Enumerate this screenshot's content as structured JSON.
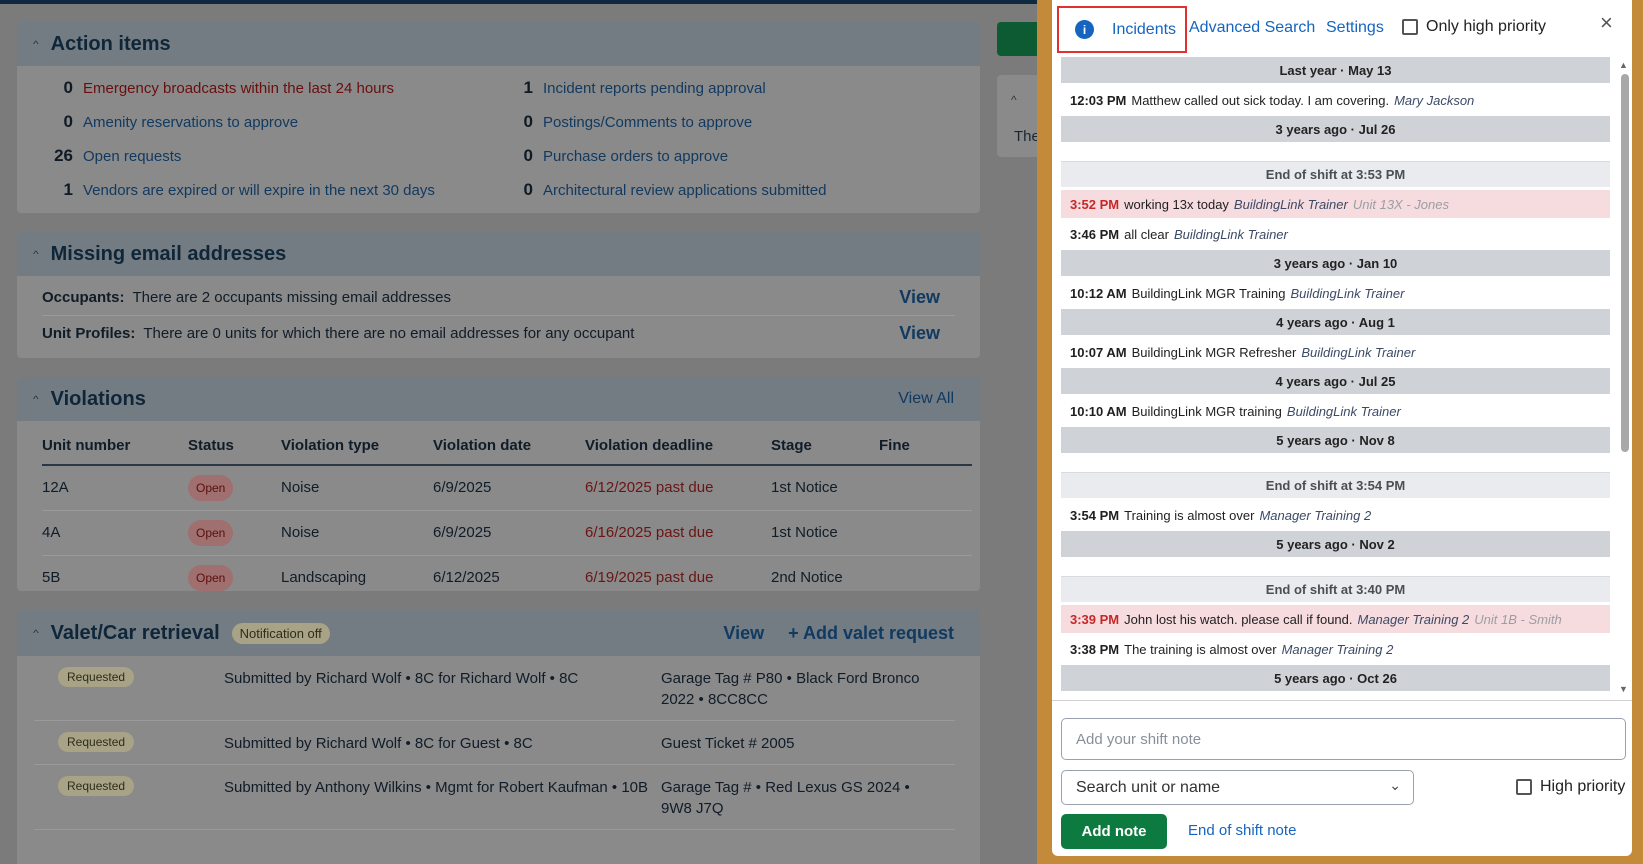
{
  "dashboard": {
    "action_items": {
      "title": "Action items",
      "items": [
        {
          "count": "0",
          "label": "Emergency broadcasts within the last 24 hours",
          "alert": true
        },
        {
          "count": "1",
          "label": "Incident reports pending approval"
        },
        {
          "count": "0",
          "label": "Amenity reservations to approve"
        },
        {
          "count": "0",
          "label": "Postings/Comments to approve"
        },
        {
          "count": "26",
          "label": "Open requests"
        },
        {
          "count": "0",
          "label": "Purchase orders to approve"
        },
        {
          "count": "1",
          "label": "Vendors are expired or will expire in the next 30 days"
        },
        {
          "count": "0",
          "label": "Architectural review applications submitted"
        }
      ]
    },
    "missing_email": {
      "title": "Missing email addresses",
      "rows": [
        {
          "label": "Occupants:",
          "text": "There are 2 occupants missing email addresses",
          "link": "View"
        },
        {
          "label": "Unit Profiles:",
          "text": "There are 0 units for which there are no email addresses for any occupant",
          "link": "View"
        }
      ]
    },
    "violations": {
      "title": "Violations",
      "view_all": "View All",
      "columns": [
        "Unit number",
        "Status",
        "Violation type",
        "Violation date",
        "Violation deadline",
        "Stage",
        "Fine"
      ],
      "rows": [
        {
          "unit": "12A",
          "status": "Open",
          "type": "Noise",
          "date": "6/9/2025",
          "deadline": "6/12/2025 past due",
          "stage": "1st Notice",
          "fine": ""
        },
        {
          "unit": "4A",
          "status": "Open",
          "type": "Noise",
          "date": "6/9/2025",
          "deadline": "6/16/2025 past due",
          "stage": "1st Notice",
          "fine": ""
        },
        {
          "unit": "5B",
          "status": "Open",
          "type": "Landscaping",
          "date": "6/12/2025",
          "deadline": "6/19/2025 past due",
          "stage": "2nd Notice",
          "fine": ""
        }
      ]
    },
    "valet": {
      "title": "Valet/Car retrieval",
      "badge": "Notification off",
      "view": "View",
      "add": "+ Add valet request",
      "rows": [
        {
          "status": "Requested",
          "by": "Submitted by Richard Wolf • 8C for Richard Wolf • 8C",
          "tag": "Garage Tag # P80 • Black Ford Bronco 2022 • 8CC8CC"
        },
        {
          "status": "Requested",
          "by": "Submitted by Richard Wolf • 8C for Guest • 8C",
          "tag": "Guest Ticket # 2005"
        },
        {
          "status": "Requested",
          "by": "Submitted by Anthony Wilkins • Mgmt for Robert Kaufman • 10B",
          "tag": "Garage Tag # • Red Lexus GS 2024 • 9W8 J7Q"
        }
      ]
    },
    "side_text": "The"
  },
  "shift_log": {
    "tabs": {
      "incidents": "Incidents",
      "advanced": "Advanced Search",
      "settings": "Settings"
    },
    "only_high_priority": "Only high priority",
    "close_icon": "×",
    "entries": [
      {
        "kind": "sep",
        "text": "Last year · May 13"
      },
      {
        "kind": "note",
        "time": "12:03 PM",
        "text": "Matthew called out sick today. I am covering.",
        "author": "Mary Jackson",
        "unit": ""
      },
      {
        "kind": "sep",
        "text": "3 years ago · Jul 26"
      },
      {
        "kind": "gap"
      },
      {
        "kind": "eos",
        "text": "End of shift at 3:53 PM"
      },
      {
        "kind": "note",
        "hi": true,
        "time": "3:52 PM",
        "text": "working 13x today",
        "author": "BuildingLink Trainer",
        "unit": "Unit 13X - Jones"
      },
      {
        "kind": "note",
        "time": "3:46 PM",
        "text": "all clear",
        "author": "BuildingLink Trainer",
        "unit": ""
      },
      {
        "kind": "sep",
        "text": "3 years ago · Jan 10"
      },
      {
        "kind": "note",
        "time": "10:12 AM",
        "text": "BuildingLink MGR Training",
        "author": "BuildingLink Trainer",
        "unit": ""
      },
      {
        "kind": "sep",
        "text": "4 years ago · Aug 1"
      },
      {
        "kind": "note",
        "time": "10:07 AM",
        "text": "BuildingLink MGR Refresher",
        "author": "BuildingLink Trainer",
        "unit": ""
      },
      {
        "kind": "sep",
        "text": "4 years ago · Jul 25"
      },
      {
        "kind": "note",
        "time": "10:10 AM",
        "text": "BuildingLink MGR training",
        "author": "BuildingLink Trainer",
        "unit": ""
      },
      {
        "kind": "sep",
        "text": "5 years ago · Nov 8"
      },
      {
        "kind": "gap"
      },
      {
        "kind": "eos",
        "text": "End of shift at 3:54 PM"
      },
      {
        "kind": "note",
        "time": "3:54 PM",
        "text": "Training is almost over",
        "author": "Manager Training 2",
        "unit": ""
      },
      {
        "kind": "sep",
        "text": "5 years ago · Nov 2"
      },
      {
        "kind": "gap"
      },
      {
        "kind": "eos",
        "text": "End of shift at 3:40 PM"
      },
      {
        "kind": "note",
        "hi": true,
        "time": "3:39 PM",
        "text": "John lost his watch. please call if found.",
        "author": "Manager Training 2",
        "unit": "Unit 1B - Smith"
      },
      {
        "kind": "note",
        "time": "3:38 PM",
        "text": "The training is almost over",
        "author": "Manager Training 2",
        "unit": ""
      },
      {
        "kind": "sep",
        "text": "5 years ago · Oct 26"
      }
    ],
    "note_placeholder": "Add your shift note",
    "unit_placeholder": "Search unit or name",
    "high_priority": "High priority",
    "add_note": "Add note",
    "end_of_shift_note": "End of shift note"
  }
}
